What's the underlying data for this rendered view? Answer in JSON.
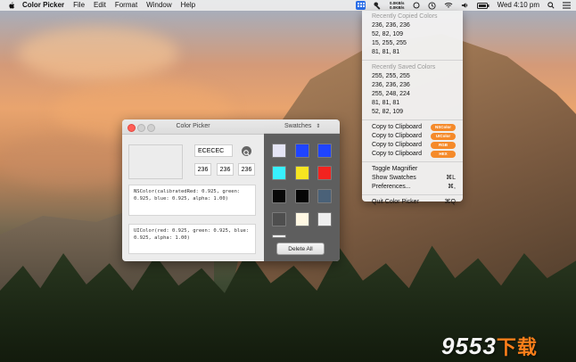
{
  "menubar": {
    "app_name": "Color Picker",
    "menus": [
      "File",
      "Edit",
      "Format",
      "Window",
      "Help"
    ],
    "net_up": "0.0KB/s",
    "net_down": "0.0KB/s",
    "clock": "Wed 4:10 pm",
    "icons": [
      "apple-icon",
      "color-picker-status-icon",
      "key-icon",
      "network-speed",
      "circle-icon",
      "timemachine-icon",
      "wifi-icon",
      "volume-icon",
      "battery-icon",
      "search-icon",
      "notification-list-icon"
    ]
  },
  "dropdown": {
    "recently_copied_header": "Recently Copied Colors",
    "recently_copied": [
      "236, 236, 236",
      "52, 82, 109",
      "15, 255, 255",
      "81, 81, 81"
    ],
    "recently_saved_header": "Recently Saved Colors",
    "recently_saved": [
      "255, 255, 255",
      "236, 236, 236",
      "255, 248, 224",
      "81, 81, 81",
      "52, 82, 109"
    ],
    "copy_items": [
      {
        "label": "Copy to Clipboard",
        "tag": "NSColor"
      },
      {
        "label": "Copy to Clipboard",
        "tag": "UIColor"
      },
      {
        "label": "Copy to Clipboard",
        "tag": "RGB"
      },
      {
        "label": "Copy to Clipboard",
        "tag": "HEX"
      }
    ],
    "toggle_magnifier": "Toggle Magnifier",
    "show_swatches": "Show Swatches",
    "show_swatches_shortcut": "⌘L",
    "preferences": "Preferences...",
    "preferences_shortcut": "⌘,",
    "quit": "Quit Color Picker",
    "quit_shortcut": "⌘Q",
    "accent_color": "#f58a2a"
  },
  "window": {
    "title": "Color Picker",
    "preview_color": "#ececec",
    "hex_value": "ECECEC",
    "r": "236",
    "g": "236",
    "b": "236",
    "nscolor_code": "NSColor(calibratedRed: 0.925, green: 0.925, blue: 0.925, alpha: 1.00)",
    "uicolor_code": "UIColor(red: 0.925, green: 0.925, blue: 0.925, alpha: 1.00)",
    "swatches_label": "Swatches",
    "swatches": [
      "#e4e4f4",
      "#1f44ff",
      "#1f44ff",
      "#38f0ff",
      "#f6e521",
      "#f2231f",
      "#080808",
      "#050505",
      "#4a6178",
      "#4e4e4e",
      "#fff8e3",
      "#efefef",
      "#f5f5f5"
    ],
    "delete_all": "Delete All"
  },
  "watermark": {
    "digits": "9553",
    "cn": "下载"
  }
}
